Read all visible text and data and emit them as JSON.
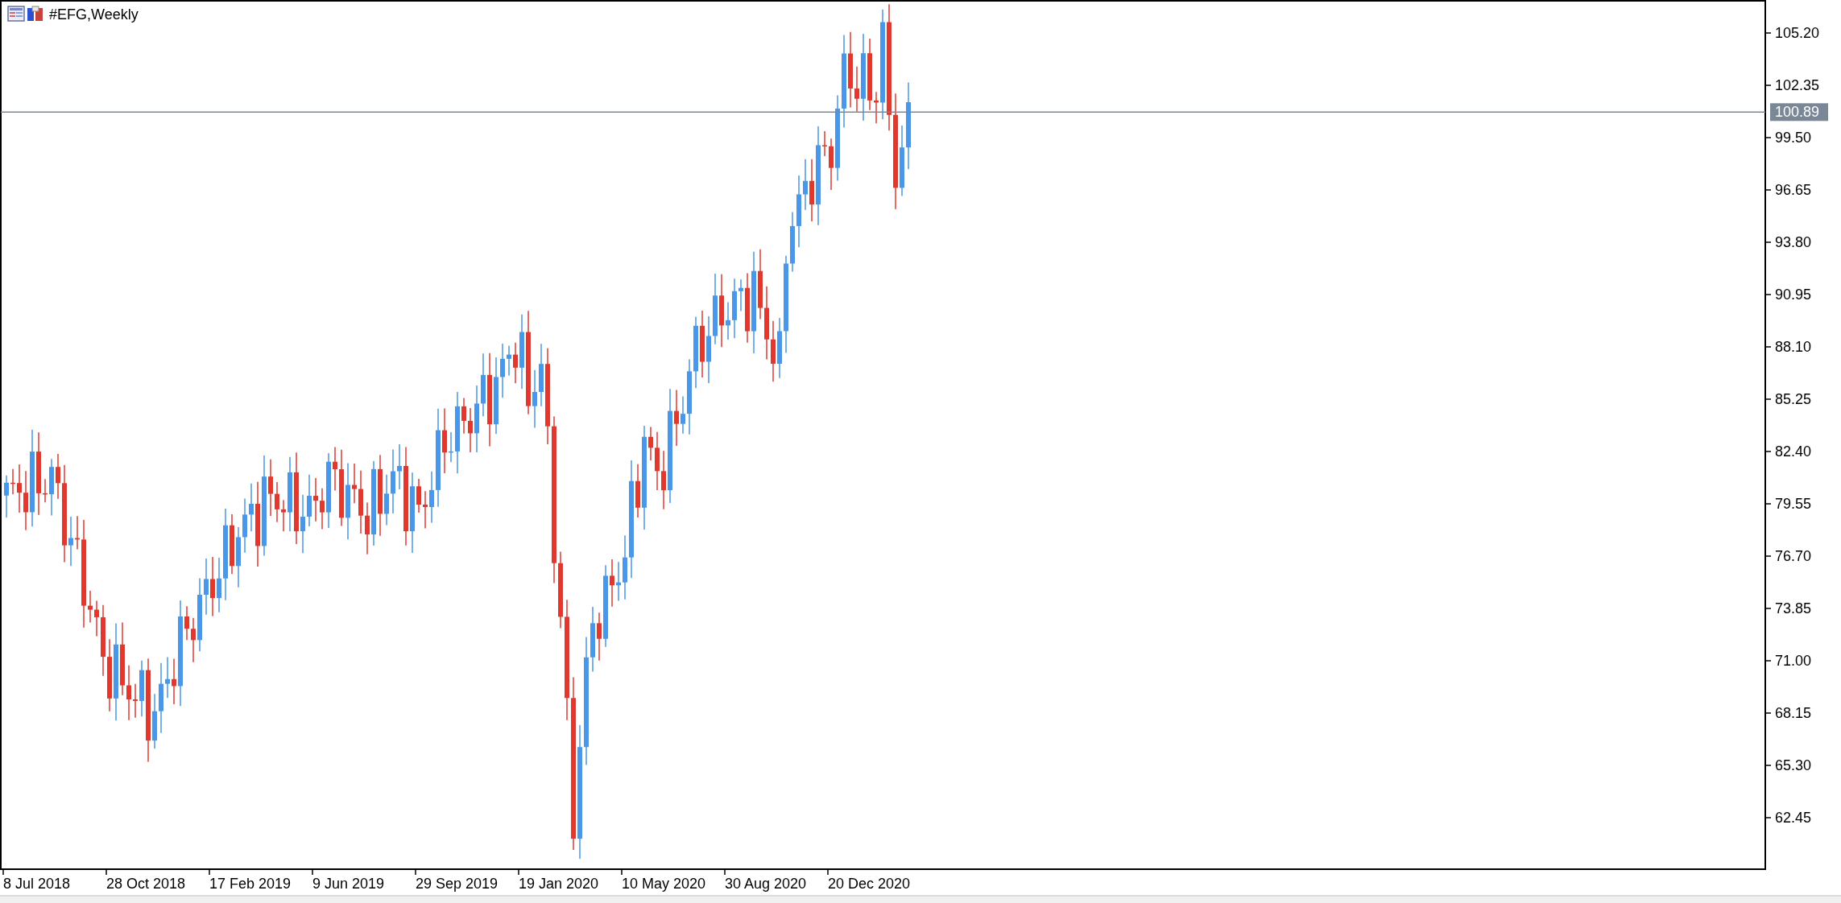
{
  "chart": {
    "title": "#EFG,Weekly",
    "price_axis": [
      "105.20",
      "102.35",
      "99.50",
      "96.65",
      "93.80",
      "90.95",
      "88.10",
      "85.25",
      "82.40",
      "79.55",
      "76.70",
      "73.85",
      "71.00",
      "68.15",
      "65.30",
      "62.45"
    ],
    "current_price": "100.89",
    "time_axis": [
      "8 Jul 2018",
      "28 Oct 2018",
      "17 Feb 2019",
      "9 Jun 2019",
      "29 Sep 2019",
      "19 Jan 2020",
      "10 May 2020",
      "30 Aug 2020",
      "20 Dec 2020"
    ]
  }
}
